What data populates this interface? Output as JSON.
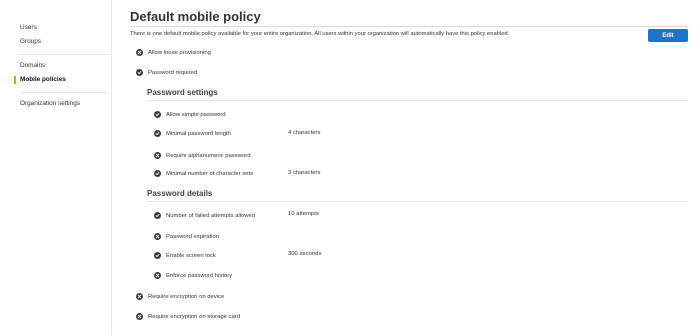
{
  "sidebar": {
    "items": [
      {
        "label": "Users"
      },
      {
        "label": "Groups"
      },
      {
        "label": "Domains"
      },
      {
        "label": "Mobile policies"
      },
      {
        "label": "Organization settings"
      }
    ]
  },
  "page": {
    "title": "Default mobile policy",
    "description": "There is one default mobile policy available for your entire organization. All users within your organization will automatically have this policy enabled.",
    "edit_label": "Edit"
  },
  "policies": {
    "allow_loose_provisioning": {
      "label": "Allow loose provisioning",
      "status": "disabled",
      "icon": "x-circle-icon"
    },
    "password_required": {
      "label": "Password required",
      "status": "enabled",
      "icon": "check-circle-icon"
    },
    "require_encryption_device": {
      "label": "Require encryption on device",
      "status": "disabled",
      "icon": "x-circle-icon"
    },
    "require_encryption_storage": {
      "label": "Require encryption on storage card",
      "status": "disabled",
      "icon": "x-circle-icon"
    }
  },
  "password_settings": {
    "title": "Password settings",
    "items": [
      {
        "label": "Allow simple password",
        "status": "enabled",
        "value": ""
      },
      {
        "label": "Minimal password length",
        "status": "enabled",
        "value": "4 characters"
      },
      {
        "label": "Require alphanumeric password",
        "status": "disabled",
        "value": ""
      },
      {
        "label": "Minimal number of character sets",
        "status": "enabled",
        "value": "3 characters"
      }
    ]
  },
  "password_details": {
    "title": "Password details",
    "items": [
      {
        "label": "Number of failed attempts allowed",
        "status": "enabled",
        "value": "10 attempts"
      },
      {
        "label": "Password expiration",
        "status": "disabled",
        "value": ""
      },
      {
        "label": "Enable screen lock",
        "status": "enabled",
        "value": "300 seconds"
      },
      {
        "label": "Enforce password history",
        "status": "disabled",
        "value": ""
      }
    ]
  },
  "colors": {
    "accent": "#1a73cc",
    "active_marker": "#e8a20c",
    "icon_fill": "#3a3a3a"
  }
}
